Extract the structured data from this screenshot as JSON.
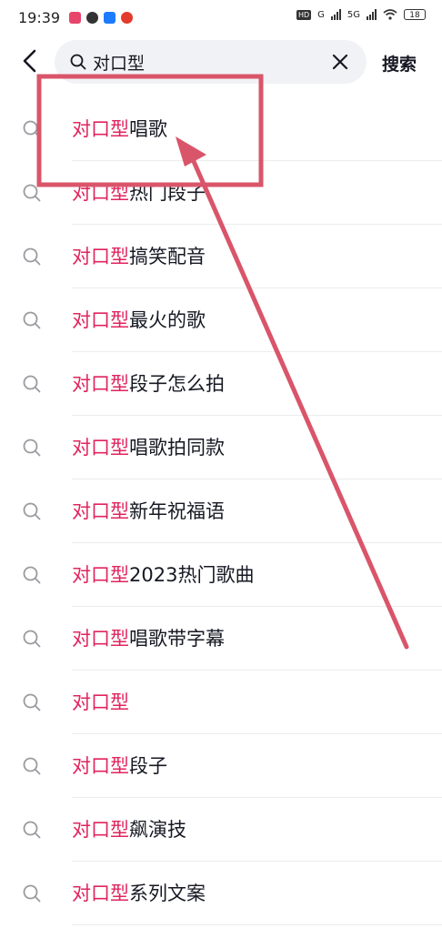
{
  "status_bar": {
    "time": "19:39",
    "network_hd": "HD",
    "network_g": "G",
    "network_5g": "5G",
    "battery": "18"
  },
  "search": {
    "query": "对口型",
    "submit_label": "搜索"
  },
  "suggestions": [
    {
      "highlight": "对口型",
      "rest": "唱歌"
    },
    {
      "highlight": "对口型",
      "rest": "热门段子"
    },
    {
      "highlight": "对口型",
      "rest": "搞笑配音"
    },
    {
      "highlight": "对口型",
      "rest": "最火的歌"
    },
    {
      "highlight": "对口型",
      "rest": "段子怎么拍"
    },
    {
      "highlight": "对口型",
      "rest": "唱歌拍同款"
    },
    {
      "highlight": "对口型",
      "rest": "新年祝福语"
    },
    {
      "highlight": "对口型",
      "rest": "2023热门歌曲"
    },
    {
      "highlight": "对口型",
      "rest": "唱歌带字幕"
    },
    {
      "highlight": "对口型",
      "rest": ""
    },
    {
      "highlight": "对口型",
      "rest": "段子"
    },
    {
      "highlight": "对口型",
      "rest": "飙演技"
    },
    {
      "highlight": "对口型",
      "rest": "系列文案"
    }
  ],
  "colors": {
    "highlight": "#e0245e",
    "annotation": "#d9556a"
  }
}
